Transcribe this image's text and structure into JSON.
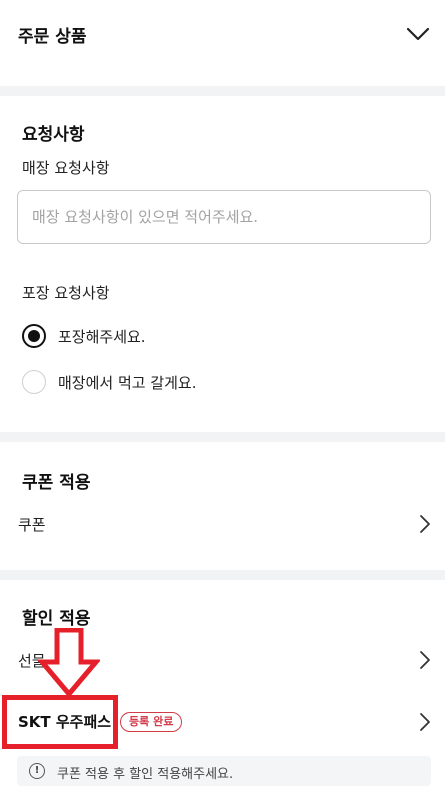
{
  "order_products": {
    "title": "주문 상품",
    "toggle_icon": "chevron-down-icon"
  },
  "request": {
    "title": "요청사항",
    "store_request_label": "매장 요청사항",
    "store_request_value": "",
    "store_request_placeholder": "매장 요청사항이 있으면 적어주세요.",
    "packaging_label": "포장 요청사항",
    "options": [
      {
        "label": "포장해주세요.",
        "checked": true
      },
      {
        "label": "매장에서 먹고 갈게요.",
        "checked": false
      }
    ]
  },
  "coupon": {
    "title": "쿠폰 적용",
    "row_label": "쿠폰"
  },
  "discount": {
    "title": "할인 적용",
    "gift_label": "선물",
    "skt_label": "SKT 우주패스",
    "skt_badge": "등록 완료",
    "notice": "쿠폰 적용 후 할인 적용해주세요."
  },
  "colors": {
    "highlight_red": "#e5202a",
    "badge_red": "#d23c4a",
    "divider": "#f2f3f5"
  },
  "icons": {
    "chevron": "chevron-right-icon",
    "notice": "info-icon",
    "annotation": "down-arrow-icon"
  }
}
